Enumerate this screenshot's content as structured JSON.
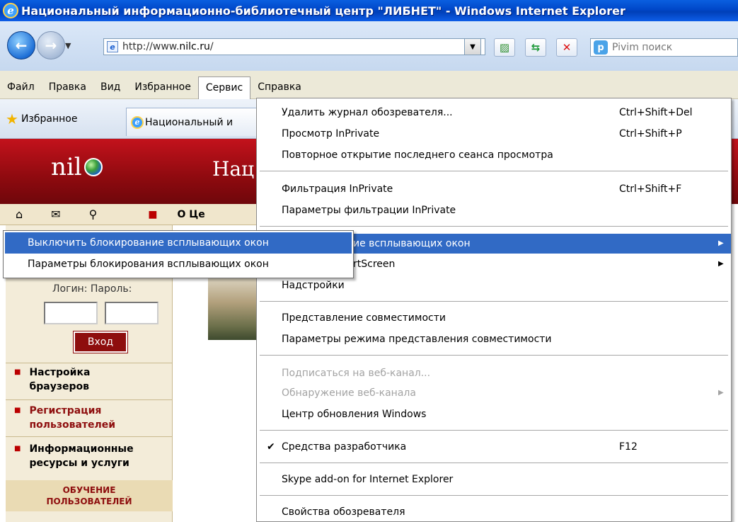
{
  "window": {
    "title": "Национальный информационно-библиотечный центр \"ЛИБНЕТ\" - Windows Internet Explorer"
  },
  "address": {
    "url_prefix": "http://www.",
    "url_domain": "nilc.ru",
    "url_suffix": "/"
  },
  "search": {
    "placeholder": "Pivim поиск"
  },
  "menubar": [
    "Файл",
    "Правка",
    "Вид",
    "Избранное",
    "Сервис",
    "Справка"
  ],
  "favorites": {
    "label": "Избранное",
    "tab_title": "Национальный и"
  },
  "page": {
    "logo": "nil",
    "heading": "Нац",
    "about": "О Це",
    "login_label": "Логин: Пароль:",
    "login_button": "Вход",
    "links": [
      [
        "Настройка",
        "браузеров"
      ],
      [
        "Регистрация",
        "пользователей"
      ],
      [
        "Информационные",
        "ресурсы и услуги"
      ]
    ],
    "obuch": [
      "ОБУЧЕНИЕ",
      "ПОЛЬЗОВАТЕЛЕЙ"
    ]
  },
  "menu": {
    "items": [
      {
        "label": "Удалить журнал обозревателя...",
        "shortcut": "Ctrl+Shift+Del"
      },
      {
        "label": "Просмотр InPrivate",
        "shortcut": "Ctrl+Shift+P"
      },
      {
        "label": "Повторное открытие последнего сеанса просмотра",
        "shortcut": ""
      },
      {
        "label": "Фильтрация InPrivate",
        "shortcut": "Ctrl+Shift+F"
      },
      {
        "label": "Параметры фильтрации InPrivate",
        "shortcut": ""
      },
      {
        "label": "ие всплывающих окон",
        "shortcut": ""
      },
      {
        "label": "rtScreen",
        "shortcut": ""
      },
      {
        "label": "Надстройки",
        "shortcut": ""
      },
      {
        "label": "Представление совместимости",
        "shortcut": ""
      },
      {
        "label": "Параметры режима представления совместимости",
        "shortcut": ""
      },
      {
        "label": "Подписаться на веб-канал...",
        "shortcut": ""
      },
      {
        "label": "Обнаружение веб-канала",
        "shortcut": ""
      },
      {
        "label": "Центр обновления Windows",
        "shortcut": ""
      },
      {
        "label": "Средства разработчика",
        "shortcut": "F12"
      },
      {
        "label": "Skype add-on for Internet Explorer",
        "shortcut": ""
      },
      {
        "label": "Свойства обозревателя",
        "shortcut": ""
      }
    ]
  },
  "submenu": {
    "items": [
      {
        "label": "Выключить блокирование всплывающих окон"
      },
      {
        "label": "Параметры блокирования всплывающих окон"
      }
    ]
  },
  "colors": {
    "highlight": "#316ac5",
    "banner": "#8e0a0f",
    "title_bar": "#0047c8"
  }
}
